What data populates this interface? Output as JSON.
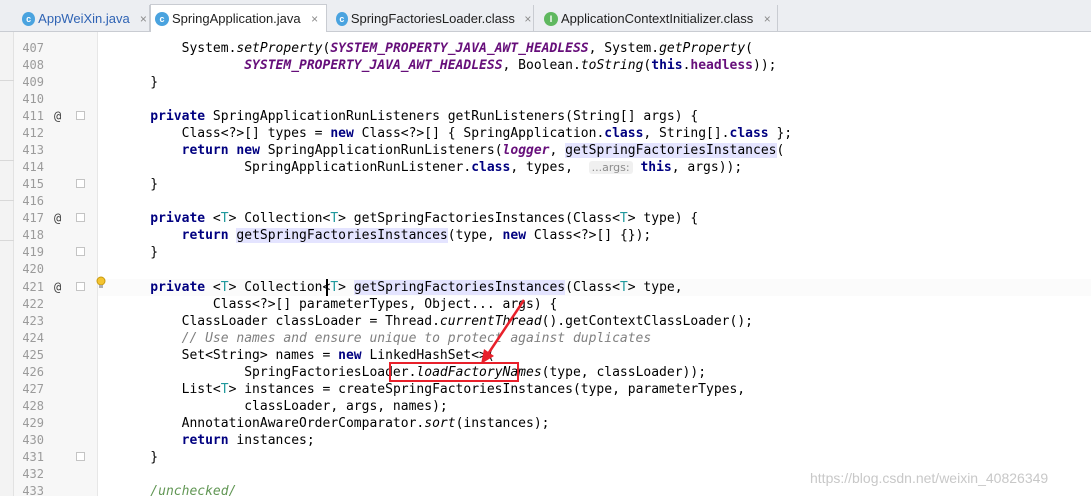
{
  "tabs": [
    {
      "name": "AppWeiXin.java",
      "icon": "java-class-icon",
      "close": "×"
    },
    {
      "name": "SpringApplication.java",
      "icon": "java-class-icon",
      "close": "×"
    },
    {
      "name": "SpringFactoriesLoader.class",
      "icon": "class-file-icon",
      "close": "×"
    },
    {
      "name": "ApplicationContextInitializer.class",
      "icon": "interface-file-icon",
      "close": "×"
    }
  ],
  "gutter": {
    "line_numbers": [
      "407",
      "408",
      "409",
      "410",
      "411",
      "412",
      "413",
      "414",
      "415",
      "416",
      "417",
      "418",
      "419",
      "420",
      "421",
      "422",
      "423",
      "424",
      "425",
      "426",
      "427",
      "428",
      "429",
      "430",
      "431",
      "432",
      "433"
    ],
    "override_marker": "@"
  },
  "code": {
    "l407": {
      "a": "        System.",
      "b": "setProperty",
      "c": "(",
      "d": "SYSTEM_PROPERTY_JAVA_AWT_HEADLESS",
      "e": ", System.",
      "f": "getProperty",
      "g": "("
    },
    "l408": {
      "a": "                ",
      "b": "SYSTEM_PROPERTY_JAVA_AWT_HEADLESS",
      "c": ", Boolean.",
      "d": "toString",
      "e": "(",
      "f": "this",
      "g": ".",
      "h": "headless",
      "i": "));"
    },
    "l409": "    }",
    "l411": {
      "kw": "    private ",
      "rest": "SpringApplicationRunListeners getRunListeners(String[] args) {"
    },
    "l412": {
      "a": "        Class<?>[] types = ",
      "b": "new",
      "c": " Class<?>[] { SpringApplication.",
      "d": "class",
      "e": ", String[].",
      "f": "class",
      "g": " };"
    },
    "l413": {
      "a": "        ",
      "b": "return new",
      "c": " SpringApplicationRunListeners(",
      "d": "logger",
      "e": ", ",
      "f": "getSpringFactoriesInstances",
      "g": "("
    },
    "l414": {
      "a": "                SpringApplicationRunListener.",
      "b": "class",
      "c": ", types,  ",
      "d": "...args:",
      "e": " ",
      "f": "this",
      "g": ", args));"
    },
    "l415": "    }",
    "l417": {
      "kw": "    private ",
      "a": "<",
      "t": "T",
      "b": "> Collection<",
      "c": "> getSpringFactoriesInstances(Class<",
      "d": "> type) {"
    },
    "l418": {
      "a": "        ",
      "kw": "return",
      "b": " ",
      "c": "getSpringFactoriesInstances",
      "d": "(type, ",
      "e": "new",
      "f": " Class<?>[] {});"
    },
    "l419": "    }",
    "l421": {
      "kw": "    private ",
      "a": "<",
      "t": "T",
      "b": "> Collection<",
      "c": "> ",
      "d": "getSpringFactoriesInstances",
      "e": "(Class<",
      "f": "> type,"
    },
    "l422": "            Class<?>[] parameterTypes, Object... args) {",
    "l423": {
      "a": "        ClassLoader classLoader = Thread.",
      "b": "currentThread",
      "c": "().getContextClassLoader();"
    },
    "l424": "        // Use names and ensure unique to protect against duplicates",
    "l425": {
      "a": "        Set<String> names = ",
      "b": "new",
      "c": " LinkedHashSet<>("
    },
    "l426": {
      "a": "                SpringFactoriesLoader.",
      "b": "loadFactoryNames",
      "c": "(type, classLoader));"
    },
    "l427": {
      "a": "        List<",
      "t": "T",
      "b": "> instances = createSpringFactoriesInstances(type, parameterTypes,"
    },
    "l428": "                classLoader, args, names);",
    "l429": {
      "a": "        AnnotationAwareOrderComparator.",
      "b": "sort",
      "c": "(instances);"
    },
    "l430": {
      "a": "        ",
      "kw": "return",
      "b": " instances;"
    },
    "l431": "    }",
    "l433": "    /unchecked/"
  },
  "watermark": "https://blog.csdn.net/weixin_40826349",
  "colors": {
    "keyword": "#000080",
    "static_field": "#660e7a",
    "comment": "#808080",
    "generic": "#20999d",
    "highlight": "#e4e4ff",
    "annotation_box": "#e8202a"
  }
}
